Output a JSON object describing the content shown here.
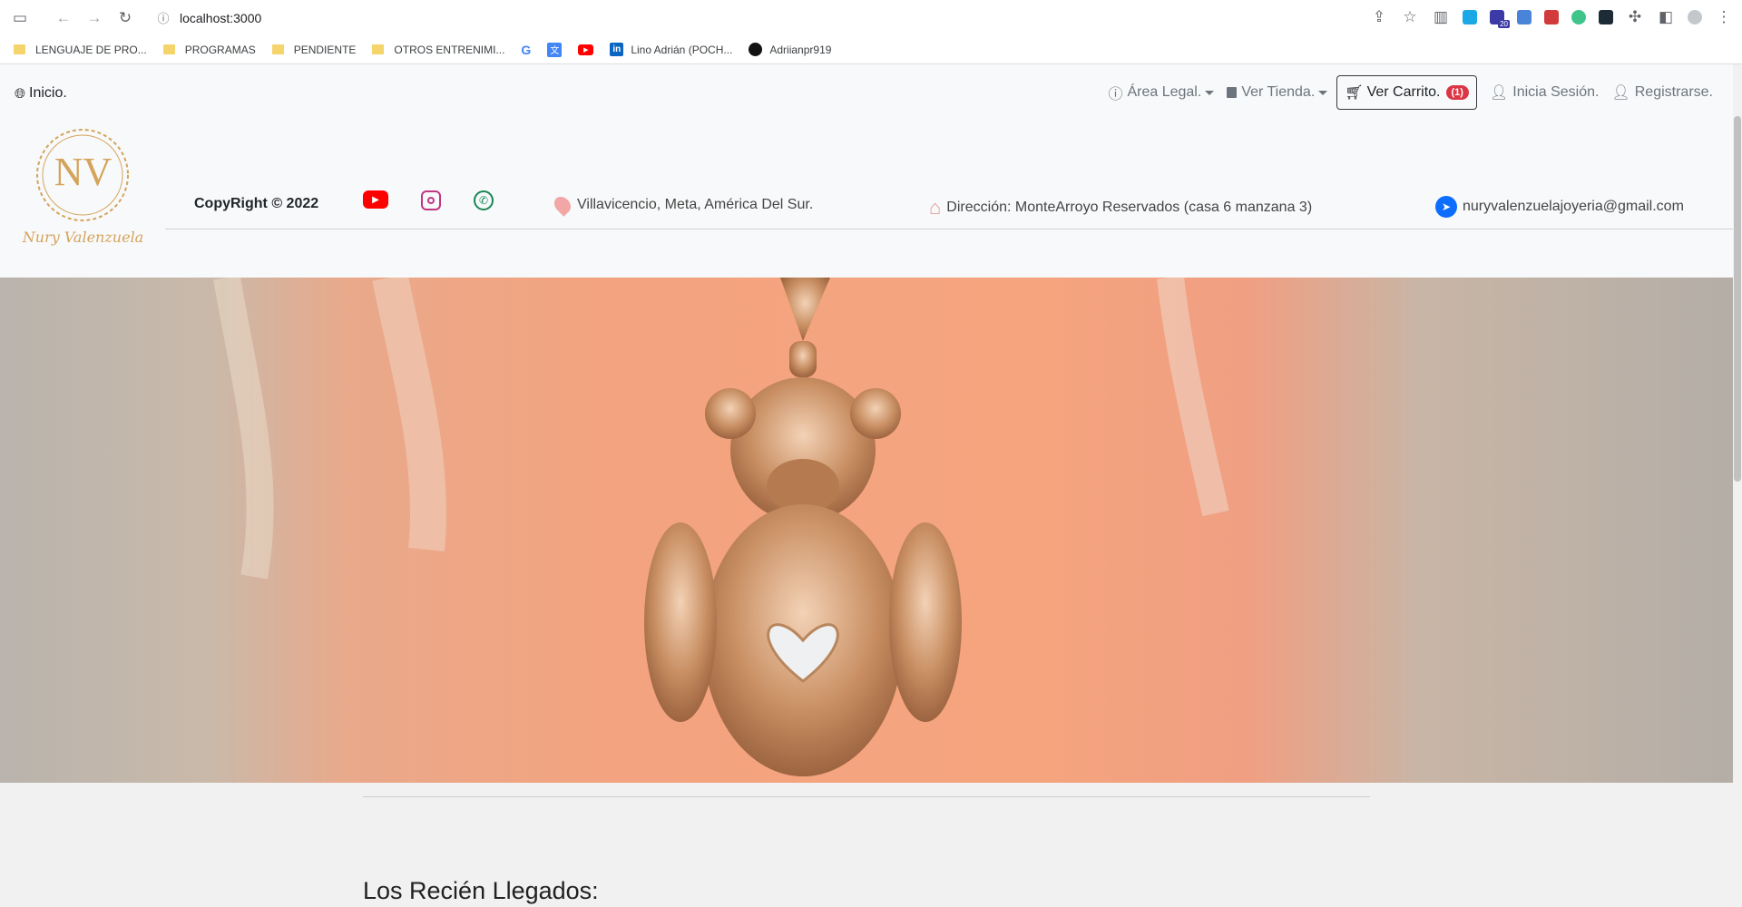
{
  "browser": {
    "url": "localhost:3000",
    "bookmarks": [
      {
        "label": "LENGUAJE DE PRO...",
        "type": "folder"
      },
      {
        "label": "PROGRAMAS",
        "type": "folder"
      },
      {
        "label": "PENDIENTE",
        "type": "folder"
      },
      {
        "label": "OTROS ENTRENIMI...",
        "type": "folder"
      },
      {
        "label": "",
        "type": "google-icon"
      },
      {
        "label": "",
        "type": "translate-icon"
      },
      {
        "label": "",
        "type": "youtube-icon"
      },
      {
        "label": "Lino Adrián (POCH...",
        "type": "linkedin-icon"
      },
      {
        "label": "Adriianpr919",
        "type": "github-icon"
      }
    ],
    "extension_badge": "20"
  },
  "header": {
    "inicio": "Inicio.",
    "nav": {
      "legal": "Área Legal.",
      "tienda": "Ver Tienda.",
      "carrito": "Ver Carrito.",
      "cart_count": "(1)",
      "login": "Inicia Sesión.",
      "register": "Registrarse."
    },
    "logo_text": "Nury Valenzuela",
    "logo_initials": "NV",
    "copyright": "CopyRight © 2022",
    "location": "Villavicencio, Meta, América Del Sur.",
    "address": "Dirección: MonteArroyo Reservados (casa 6 manzana 3)",
    "email": "nuryvalenzuelajoyeria@gmail.com"
  },
  "main": {
    "section_title": "Los Recién Llegados:"
  },
  "colors": {
    "youtube": "#ff0000",
    "instagram": "#c13584",
    "whatsapp": "#198754",
    "gold": "#d4a45c",
    "telegram": "#0d6efd",
    "cart_badge": "#dc3545"
  }
}
